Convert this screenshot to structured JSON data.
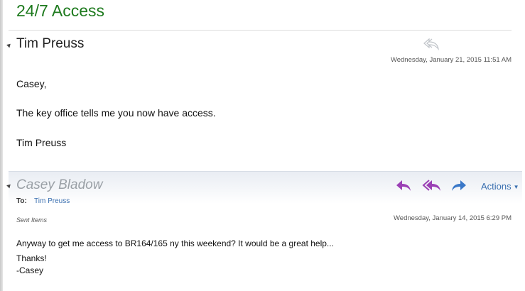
{
  "conversation": {
    "subject": "24/7 Access"
  },
  "message1": {
    "sender": "Tim Preuss",
    "date": "Wednesday, January 21, 2015 11:51 AM",
    "body_lines": [
      "Casey,",
      "The key office tells me you now have access.",
      "Tim Preuss"
    ]
  },
  "message2": {
    "sender": "Casey Bladow",
    "to_label": "To:",
    "to_value": "Tim Preuss",
    "folder": "Sent Items",
    "date": "Wednesday, January 14, 2015 6:29 PM",
    "actions_label": "Actions",
    "body_lines": [
      "Anyway to get me access to BR164/165 ny this weekend? It would be a great help...",
      "Thanks!",
      "-Casey"
    ]
  },
  "colors": {
    "subject": "#1e7a1e",
    "link": "#3a6fb0",
    "reply_icon": "#9b3fb5",
    "forward_icon": "#3a78c8"
  },
  "icons": [
    "reply-all-icon",
    "reply-icon",
    "forward-icon",
    "expand-triangle-icon",
    "chevron-down-icon"
  ]
}
